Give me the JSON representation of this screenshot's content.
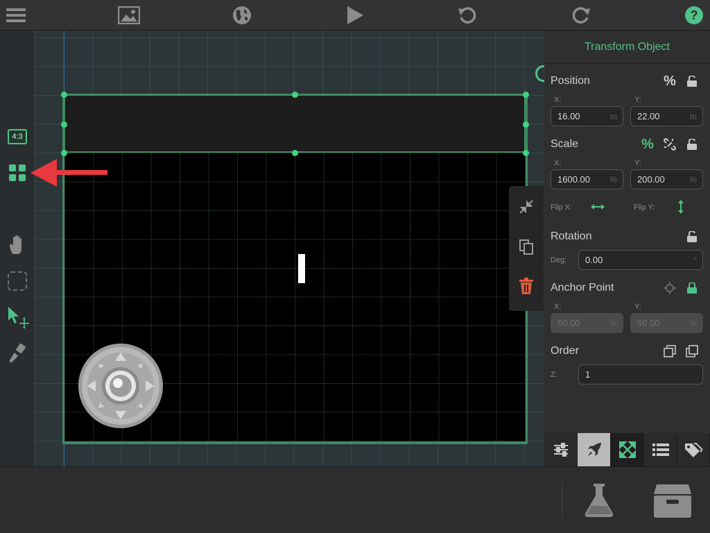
{
  "toolbar": {
    "menu_icon": "hamburger-icon",
    "gallery_icon": "image-icon",
    "world_icon": "globe-icon",
    "play_icon": "play-icon",
    "undo_icon": "undo-icon",
    "redo_icon": "redo-icon",
    "help_icon": "help-icon"
  },
  "left_tools": {
    "aspect_label": "4:3",
    "grid_icon": "grid-icon",
    "pan_icon": "hand-icon",
    "select_icon": "marquee-icon",
    "move_icon": "cursor-move-icon",
    "paint_icon": "brush-icon"
  },
  "colors": {
    "accent": "#4fc28a",
    "handle": "#3fd47f",
    "delete": "#e05a3a",
    "arrow": "#e8393f",
    "scene_border": "#3a6fa0"
  },
  "context_menu": [
    "shrink-icon",
    "duplicate-icon",
    "trash-icon"
  ],
  "panel": {
    "title": "Transform Object",
    "position": {
      "label": "Position",
      "x_label": "X:",
      "x_value": "16.00",
      "x_unit": "m",
      "y_label": "Y:",
      "y_value": "22.00",
      "y_unit": "m"
    },
    "scale": {
      "label": "Scale",
      "x_label": "X:",
      "x_value": "1600.00",
      "x_unit": "%",
      "y_label": "Y:",
      "y_value": "200.00",
      "y_unit": "%",
      "flip_x_label": "Flip X:",
      "flip_y_label": "Flip Y:"
    },
    "rotation": {
      "label": "Rotation",
      "deg_label": "Deg:",
      "deg_value": "0.00",
      "deg_unit": "°"
    },
    "anchor": {
      "label": "Anchor Point",
      "x_label": "X:",
      "x_value": "50.00",
      "x_unit": "%",
      "y_label": "Y:",
      "y_value": "50.00",
      "y_unit": "%"
    },
    "order": {
      "label": "Order",
      "z_label": "Z:",
      "z_value": "1"
    },
    "tabs": [
      "sliders-icon",
      "rocket-icon",
      "transform-icon",
      "list-icon",
      "tags-icon"
    ]
  },
  "bottom": {
    "lab_icon": "flask-icon",
    "storage_icon": "drawer-icon"
  }
}
